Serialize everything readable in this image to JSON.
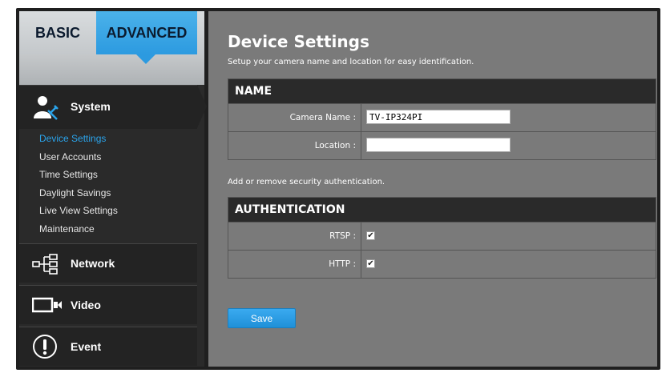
{
  "tabs": {
    "basic": "BASIC",
    "advanced": "ADVANCED"
  },
  "sidebar": {
    "system": {
      "label": "System",
      "icon": "admin-user-icon",
      "items": [
        {
          "label": "Device Settings",
          "active": true
        },
        {
          "label": "User Accounts"
        },
        {
          "label": "Time Settings"
        },
        {
          "label": "Daylight Savings"
        },
        {
          "label": "Live View Settings"
        },
        {
          "label": "Maintenance"
        }
      ]
    },
    "network": {
      "label": "Network",
      "icon": "network-tree-icon"
    },
    "video": {
      "label": "Video",
      "icon": "video-camera-icon"
    },
    "event": {
      "label": "Event",
      "icon": "alert-icon"
    }
  },
  "main": {
    "title": "Device Settings",
    "subtitle": "Setup your camera name and location for easy identification.",
    "name_section": {
      "header": "NAME",
      "camera_name_label": "Camera Name :",
      "camera_name_value": "TV-IP324PI",
      "location_label": "Location :",
      "location_value": ""
    },
    "auth_note": "Add or remove security authentication.",
    "auth_section": {
      "header": "AUTHENTICATION",
      "rtsp_label": "RTSP :",
      "rtsp_checked": true,
      "http_label": "HTTP :",
      "http_checked": true
    },
    "save_label": "Save"
  },
  "colors": {
    "accent": "#2c9ae0",
    "active_link": "#2aa3ea",
    "sidebar_bg": "#2a2a2a",
    "content_bg": "#7a7a7a"
  }
}
